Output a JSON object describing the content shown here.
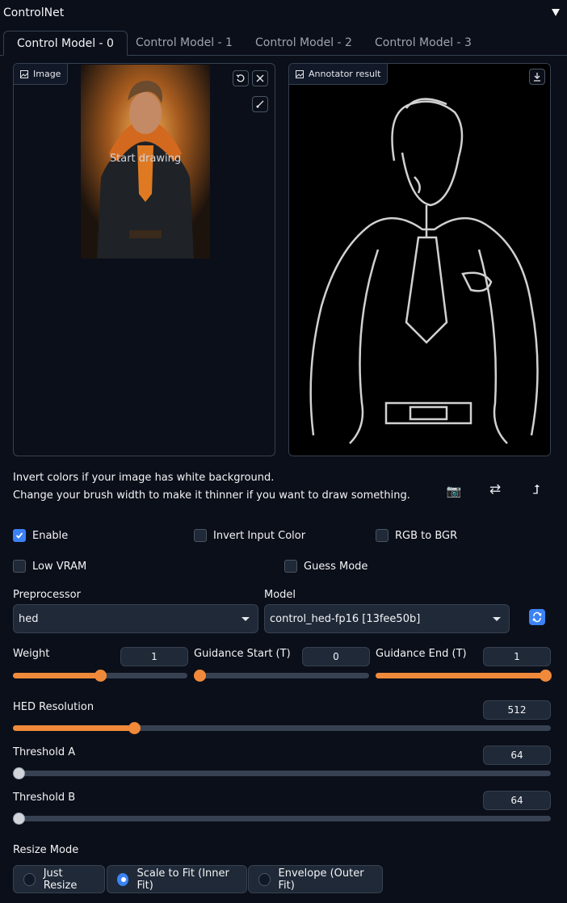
{
  "header": {
    "title": "ControlNet"
  },
  "tabs": [
    {
      "label": "Control Model - 0",
      "active": true
    },
    {
      "label": "Control Model - 1",
      "active": false
    },
    {
      "label": "Control Model - 2",
      "active": false
    },
    {
      "label": "Control Model - 3",
      "active": false
    }
  ],
  "image_panel": {
    "label": "Image",
    "overlay_text": "Start drawing"
  },
  "annotator_panel": {
    "label": "Annotator result"
  },
  "hints": {
    "line1": "Invert colors if your image has white background.",
    "line2": "Change your brush width to make it thinner if you want to draw something."
  },
  "tool_icons": {
    "camera": "📷",
    "swap": "⇄",
    "send": "⮥"
  },
  "checkboxes": {
    "enable": {
      "label": "Enable",
      "checked": true
    },
    "invert_input_color": {
      "label": "Invert Input Color",
      "checked": false
    },
    "rgb_to_bgr": {
      "label": "RGB to BGR",
      "checked": false
    },
    "low_vram": {
      "label": "Low VRAM",
      "checked": false
    },
    "guess_mode": {
      "label": "Guess Mode",
      "checked": false
    }
  },
  "preprocessor": {
    "label": "Preprocessor",
    "value": "hed"
  },
  "model": {
    "label": "Model",
    "value": "control_hed-fp16 [13fee50b]"
  },
  "sliders": {
    "weight": {
      "label": "Weight",
      "value": "1",
      "min": 0,
      "max": 2,
      "num": 1
    },
    "guidance_start": {
      "label": "Guidance Start (T)",
      "value": "0",
      "min": 0,
      "max": 1,
      "num": 0
    },
    "guidance_end": {
      "label": "Guidance End (T)",
      "value": "1",
      "min": 0,
      "max": 1,
      "num": 1
    },
    "hed_resolution": {
      "label": "HED Resolution",
      "value": "512",
      "min": 64,
      "max": 2048,
      "num": 512
    },
    "threshold_a": {
      "label": "Threshold A",
      "value": "64",
      "min": 64,
      "max": 1024,
      "num": 64
    },
    "threshold_b": {
      "label": "Threshold B",
      "value": "64",
      "min": 64,
      "max": 1024,
      "num": 64
    }
  },
  "resize_mode": {
    "label": "Resize Mode",
    "options": [
      "Just Resize",
      "Scale to Fit (Inner Fit)",
      "Envelope (Outer Fit)"
    ],
    "selected": "Scale to Fit (Inner Fit)"
  },
  "colors": {
    "accent": "#f08a3a",
    "checkbox": "#3b82f6",
    "background": "#0b0f19"
  }
}
